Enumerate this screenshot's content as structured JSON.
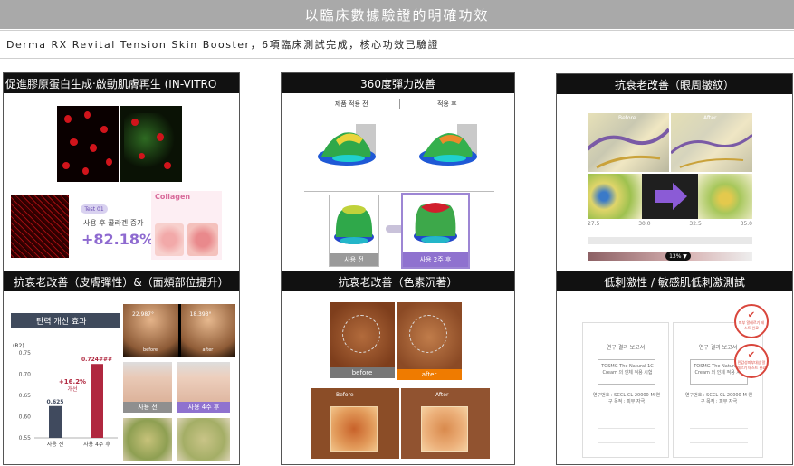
{
  "header": {
    "title": "以臨床數據驗證的明確功效",
    "subtitle": "Derma RX Revital Tension Skin Booster，6項臨床測試完成，核心功效已驗證"
  },
  "panels": {
    "p1": {
      "title": "促進膠原蛋白生成‧啟動肌膚再生 (IN-VITRO",
      "badge": "Test 01",
      "collagen": "Collagen",
      "caption": "사용 후 콜라겐 증가",
      "value": "+82.18%"
    },
    "p2": {
      "title": "360度彈力改善",
      "before_hdr": "제품 적용 전",
      "after_hdr": "적용 후",
      "btn_before": "사용 전",
      "btn_after": "사용 2주 후"
    },
    "p3": {
      "title": "抗衰老改善（眼周皺紋）",
      "before": "Before",
      "after": "After",
      "ticks": [
        "27.5",
        "30.0",
        "32.5",
        "35.0"
      ],
      "badge": "13% ▼"
    },
    "p4": {
      "title": "抗衰老改善（皮膚彈性）&（面頰部位提升）",
      "chart_title": "탄력 개선 효과",
      "before_val": "22.987°",
      "after_val": "18.393°",
      "before_lbl": "before",
      "after_lbl": "after",
      "btn_before": "사용 전",
      "btn_after": "사용 4주 후"
    },
    "p5": {
      "title": "抗衰老改善（色素沉著）",
      "before": "before",
      "after": "after",
      "before2": "Before",
      "after2": "After"
    },
    "p6": {
      "title": "低刺激性 / 敏感肌低刺激測試",
      "stamp1": "피부 알레르기 테스트 완료",
      "stamp2": "민감성피부대상 알레르기 테스트 완료",
      "doc_title": "연구 결과 보고서",
      "doc_box1": "TOSMG The Natural 1C Cream 의 인체 적용 시험",
      "doc_box2": "연구번호 : SCCL-CL-20000-M 연구 목적 : 피부 자극"
    }
  },
  "chart_data": {
    "type": "bar",
    "title": "탄력 개선 효과",
    "categories": [
      "사용 전",
      "사용 4주 후"
    ],
    "values": [
      0.625,
      0.724
    ],
    "value_labels": [
      "0.625",
      "0.724###"
    ],
    "annotation": "+16.2% 개선",
    "ylabel": "(R2)",
    "ylim": [
      0.55,
      0.75
    ],
    "yticks": [
      "0.75",
      "0.70",
      "0.65",
      "0.60",
      "0.55"
    ],
    "colors": [
      "#404a5e",
      "#b0283f"
    ],
    "grid": false
  }
}
